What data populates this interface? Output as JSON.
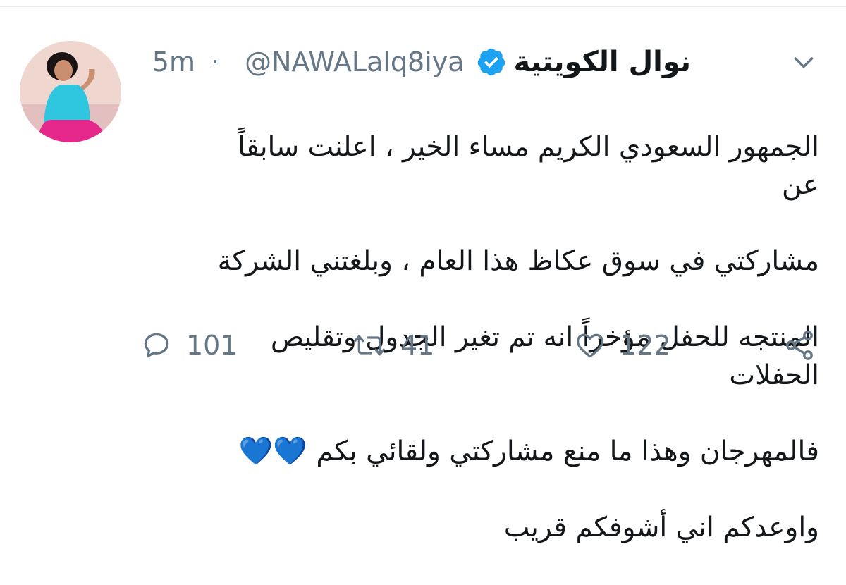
{
  "tweet": {
    "display_name": "نوال الكويتية",
    "handle": "@NAWALalq8iya",
    "separator": "·",
    "time": "5m",
    "text_lines": [
      "الجمهور السعودي الكريم مساء الخير ، اعلنت سابقاً عن",
      "مشاركتي في سوق عكاظ هذا العام ، وبلغتني الشركة",
      "المنتجه للحفل مؤخراً انه تم تغير الجدول وتقليص الحفلات",
      "فالمهرجان وهذا ما منع مشاركتي ولقائي بكم 💙💙",
      "واوعدكم اني أشوفكم قريب"
    ]
  },
  "actions": {
    "replies": "101",
    "retweets": "41",
    "likes": "122"
  },
  "icons": {
    "verified": "verified-icon",
    "menu": "chevron-down-icon",
    "reply": "reply-icon",
    "retweet": "retweet-icon",
    "like": "heart-icon",
    "share": "share-icon"
  },
  "colors": {
    "verified_blue": "#1da1f2",
    "muted_gray": "#657786",
    "heart_blue": "#5da9e9",
    "text": "#14171a"
  }
}
